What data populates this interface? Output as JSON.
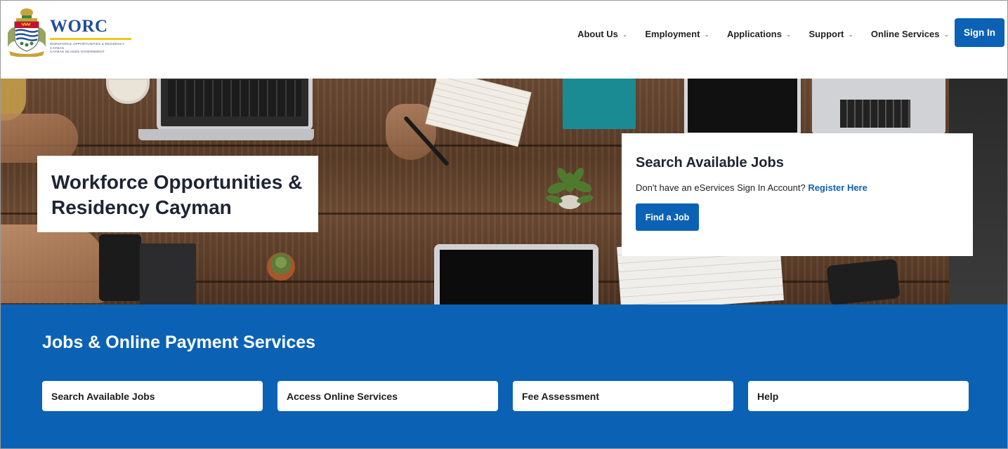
{
  "header": {
    "logo": {
      "name": "WORC",
      "subtitle_line1": "Workforce Opportunities & Residency Cayman",
      "subtitle_line2": "Cayman Islands Government"
    },
    "nav": [
      {
        "label": "About Us",
        "icon": "chevron-down-icon"
      },
      {
        "label": "Employment",
        "icon": "chevron-down-icon"
      },
      {
        "label": "Applications",
        "icon": "chevron-down-icon"
      },
      {
        "label": "Support",
        "icon": "chevron-down-icon"
      },
      {
        "label": "Online Services",
        "icon": "chevron-down-icon"
      }
    ],
    "sign_in_label": "Sign In"
  },
  "hero": {
    "title": "Workforce Opportunities & Residency Cayman",
    "search_card": {
      "heading": "Search Available Jobs",
      "prompt_text": "Don't have an eServices Sign In Account?",
      "register_link": "Register Here",
      "button_label": "Find a Job"
    }
  },
  "services": {
    "heading": "Jobs & Online Payment Services",
    "tiles": [
      {
        "label": "Search Available Jobs"
      },
      {
        "label": "Access Online Services"
      },
      {
        "label": "Fee Assessment"
      },
      {
        "label": "Help"
      }
    ]
  },
  "colors": {
    "brand_blue": "#0b62b5",
    "logo_blue": "#1f4e9a",
    "logo_gold": "#f2c517"
  }
}
